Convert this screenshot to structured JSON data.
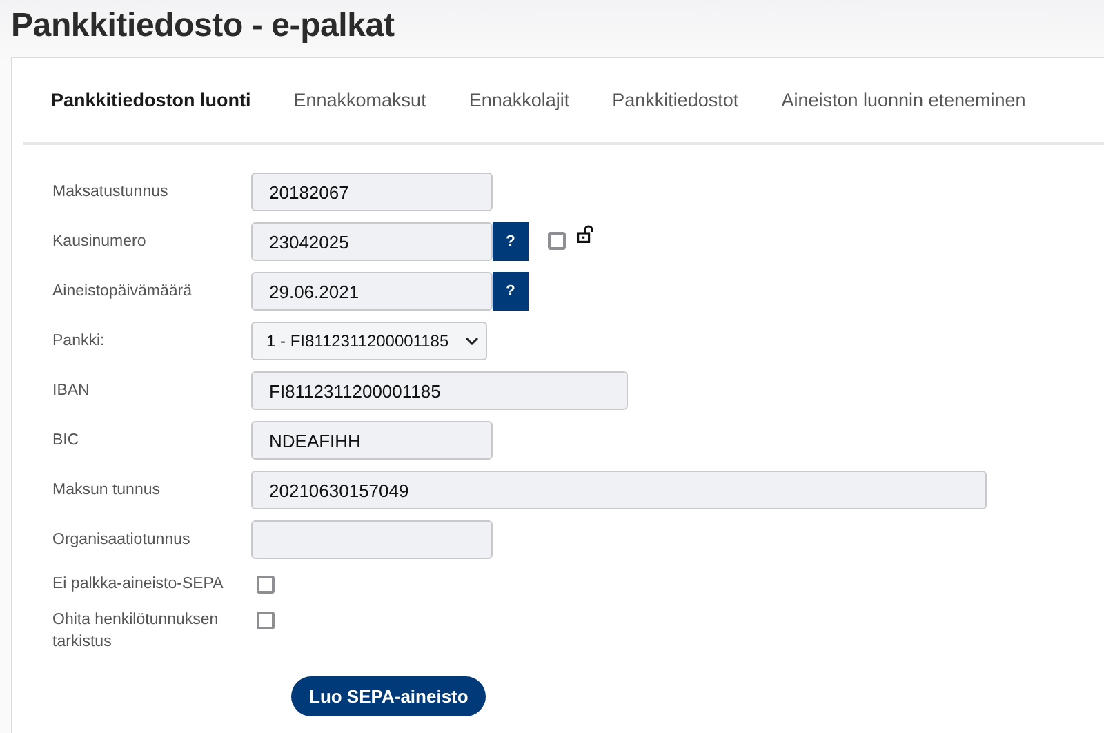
{
  "page": {
    "title": "Pankkitiedosto - e-palkat"
  },
  "tabs": [
    {
      "label": "Pankkitiedoston luonti",
      "selected": true
    },
    {
      "label": "Ennakkomaksut",
      "selected": false
    },
    {
      "label": "Ennakkolajit",
      "selected": false
    },
    {
      "label": "Pankkitiedostot",
      "selected": false
    },
    {
      "label": "Aineiston luonnin eteneminen",
      "selected": false
    }
  ],
  "form": {
    "rows": [
      {
        "kind": "text",
        "label": "Maksatustunnus",
        "value": "20182067"
      },
      {
        "kind": "text",
        "label": "Kausinumero",
        "value": "23042025",
        "help": "?",
        "lock_checkbox": {
          "checked": false
        }
      },
      {
        "kind": "text",
        "label": "Aineistopäivämäärä",
        "value": "29.06.2021",
        "help": "?"
      },
      {
        "kind": "select",
        "label": "Pankki:",
        "value": "1 - FI8112311200001185"
      },
      {
        "kind": "text",
        "label": "IBAN",
        "value": "FI8112311200001185"
      },
      {
        "kind": "text",
        "label": "BIC",
        "value": "NDEAFIHH"
      },
      {
        "kind": "text",
        "label": "Maksun tunnus",
        "value": "20210630157049"
      },
      {
        "kind": "text",
        "label": "Organisaatiotunnus"
      },
      {
        "kind": "checkbox",
        "label": "Ei palkka-aineisto-SEPA",
        "checked": false
      },
      {
        "kind": "checkbox",
        "label": "Ohita henkilötunnuksen tarkistus",
        "checked": false
      }
    ],
    "submit": "Luo SEPA-aineisto"
  }
}
